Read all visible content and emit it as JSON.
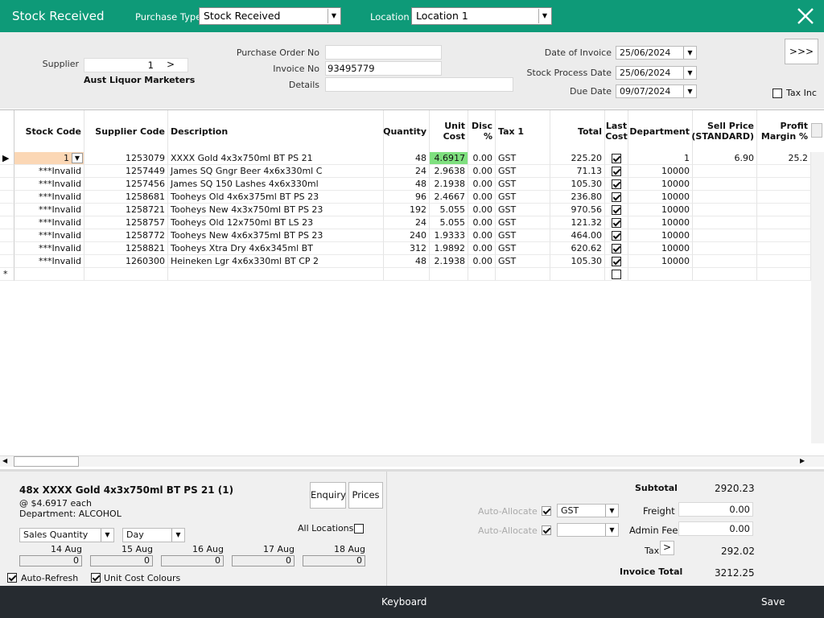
{
  "title": "Stock Received",
  "header": {
    "purchase_type_label": "Purchase Type",
    "purchase_type_value": "Stock Received",
    "location_label": "Location",
    "location_value": "Location 1"
  },
  "form": {
    "supplier_label": "Supplier",
    "supplier_value": "1",
    "supplier_button": ">",
    "supplier_name": "Aust Liquor Marketers",
    "po_label": "Purchase Order No",
    "po_value": "",
    "invoice_no_label": "Invoice No",
    "invoice_no_value": "93495779",
    "details_label": "Details",
    "details_value": "",
    "date_invoice_label": "Date of Invoice",
    "date_invoice_value": "25/06/2024",
    "stock_process_label": "Stock Process Date",
    "stock_process_value": "25/06/2024",
    "due_date_label": "Due Date",
    "due_date_value": "09/07/2024",
    "more_button": ">>>",
    "tax_inc_label": "Tax Inc"
  },
  "grid": {
    "columns": {
      "stock_code": "Stock Code",
      "supplier_code": "Supplier Code",
      "description": "Description",
      "quantity": "Quantity",
      "unit_cost_1": "Unit",
      "unit_cost_2": "Cost",
      "disc_1": "Disc",
      "disc_2": "%",
      "tax": "Tax 1",
      "total": "Total",
      "last_cost_1": "Last",
      "last_cost_2": "Cost",
      "department": "Department",
      "sell_price_1": "Sell Price",
      "sell_price_2": "(STANDARD)",
      "profit_1": "Profit",
      "profit_2": "Margin %"
    },
    "rows": [
      {
        "stock_code": "1",
        "supplier_code": "1253079",
        "description": "XXXX Gold 4x3x750ml BT PS 21",
        "quantity": "48",
        "unit_cost": "4.6917",
        "disc": "0.00",
        "tax": "GST",
        "total": "225.20",
        "last_cost": true,
        "department": "1",
        "sell_price": "6.90",
        "profit": "25.2"
      },
      {
        "stock_code": "***Invalid",
        "supplier_code": "1257449",
        "description": "James SQ Gngr Beer 4x6x330ml C",
        "quantity": "24",
        "unit_cost": "2.9638",
        "disc": "0.00",
        "tax": "GST",
        "total": "71.13",
        "last_cost": true,
        "department": "10000",
        "sell_price": "",
        "profit": ""
      },
      {
        "stock_code": "***Invalid",
        "supplier_code": "1257456",
        "description": "James SQ 150 Lashes 4x6x330ml",
        "quantity": "48",
        "unit_cost": "2.1938",
        "disc": "0.00",
        "tax": "GST",
        "total": "105.30",
        "last_cost": true,
        "department": "10000",
        "sell_price": "",
        "profit": ""
      },
      {
        "stock_code": "***Invalid",
        "supplier_code": "1258681",
        "description": "Tooheys Old 4x6x375ml BT PS 23",
        "quantity": "96",
        "unit_cost": "2.4667",
        "disc": "0.00",
        "tax": "GST",
        "total": "236.80",
        "last_cost": true,
        "department": "10000",
        "sell_price": "",
        "profit": ""
      },
      {
        "stock_code": "***Invalid",
        "supplier_code": "1258721",
        "description": "Tooheys New 4x3x750ml BT PS 23",
        "quantity": "192",
        "unit_cost": "5.055",
        "disc": "0.00",
        "tax": "GST",
        "total": "970.56",
        "last_cost": true,
        "department": "10000",
        "sell_price": "",
        "profit": ""
      },
      {
        "stock_code": "***Invalid",
        "supplier_code": "1258757",
        "description": "Tooheys Old 12x750ml BT LS 23",
        "quantity": "24",
        "unit_cost": "5.055",
        "disc": "0.00",
        "tax": "GST",
        "total": "121.32",
        "last_cost": true,
        "department": "10000",
        "sell_price": "",
        "profit": ""
      },
      {
        "stock_code": "***Invalid",
        "supplier_code": "1258772",
        "description": "Tooheys New 4x6x375ml BT PS 23",
        "quantity": "240",
        "unit_cost": "1.9333",
        "disc": "0.00",
        "tax": "GST",
        "total": "464.00",
        "last_cost": true,
        "department": "10000",
        "sell_price": "",
        "profit": ""
      },
      {
        "stock_code": "***Invalid",
        "supplier_code": "1258821",
        "description": "Tooheys Xtra Dry 4x6x345ml BT",
        "quantity": "312",
        "unit_cost": "1.9892",
        "disc": "0.00",
        "tax": "GST",
        "total": "620.62",
        "last_cost": true,
        "department": "10000",
        "sell_price": "",
        "profit": ""
      },
      {
        "stock_code": "***Invalid",
        "supplier_code": "1260300",
        "description": "Heineken Lgr 4x6x330ml BT CP 2",
        "quantity": "48",
        "unit_cost": "2.1938",
        "disc": "0.00",
        "tax": "GST",
        "total": "105.30",
        "last_cost": true,
        "department": "10000",
        "sell_price": "",
        "profit": ""
      }
    ],
    "new_row_marker": "*",
    "current_row_marker": "▶"
  },
  "detail": {
    "item_title": "48x XXXX Gold 4x3x750ml BT PS 21 (1)",
    "each_price": "@ $4.6917 each",
    "department": "Department: ALCOHOL",
    "enquiry_button": "Enquiry",
    "prices_button": "Prices",
    "quantity_select": "Sales Quantity",
    "period_select": "Day",
    "all_locations_label": "All Locations",
    "dates": [
      "14 Aug",
      "15 Aug",
      "16 Aug",
      "17 Aug",
      "18 Aug"
    ],
    "date_values": [
      "0",
      "0",
      "0",
      "0",
      "0"
    ],
    "auto_refresh_label": "Auto-Refresh",
    "unit_cost_colours_label": "Unit Cost Colours"
  },
  "totals": {
    "auto_allocate_1": "Auto-Allocate",
    "auto_allocate_2": "Auto-Allocate",
    "tax_code": "GST",
    "tax_code_2": "",
    "subtotal_label": "Subtotal",
    "subtotal_value": "2920.23",
    "freight_label": "Freight",
    "freight_value": "0.00",
    "admin_fee_label": "Admin Fee",
    "admin_fee_value": "0.00",
    "tax_label": "Tax",
    "tax_button": ">",
    "tax_value": "292.02",
    "invoice_total_label": "Invoice Total",
    "invoice_total_value": "3212.25"
  },
  "footer": {
    "keyboard": "Keyboard",
    "save": "Save"
  },
  "colors": {
    "titlebar": "#0e9a78",
    "footer": "#262b30",
    "unit_cost_highlight": "#7fe07f",
    "stock_code_highlight": "#fbd7b5"
  }
}
